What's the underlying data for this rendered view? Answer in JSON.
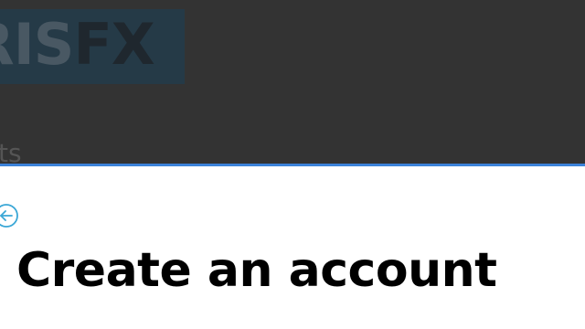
{
  "brand": {
    "logo_main": "RIS",
    "logo_accent": "FX"
  },
  "backdrop": {
    "partial_text": "ts"
  },
  "sheet": {
    "back_icon": "back-arrow-circle-icon",
    "title": "Create an account"
  },
  "colors": {
    "backdrop": "#333333",
    "logo_background": "#253a47",
    "accent_border": "#3b82d9",
    "back_icon": "#3aa7d6",
    "title": "#000000"
  }
}
